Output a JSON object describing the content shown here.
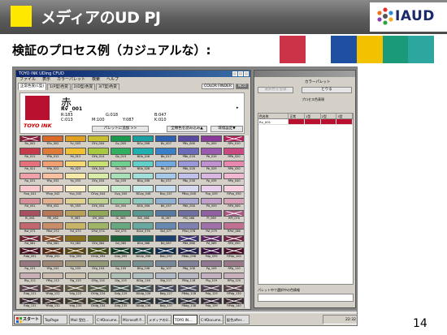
{
  "slide": {
    "title": "メディアのUD PJ",
    "subtitle": "検証のプロセス例（カジュアルな）:",
    "page_number": "14",
    "logo_text": "IAUD",
    "strip_colors": [
      "#cc3348",
      "#ffffff",
      "#1e4fa0",
      "#f2c200",
      "#1a9a78",
      "#2ea6a0"
    ]
  },
  "app": {
    "window_title": "TOYO INK UDing CFUD",
    "menu": [
      "ファイル",
      "表示",
      "カラーパレット",
      "検索",
      "ヘルプ"
    ],
    "tabs": [
      "正常色覚(C型)",
      "1(P型)色覚",
      "2(D型)色覚",
      "3(T型)色覚"
    ],
    "color_finder_label": "COLOR FINDER",
    "nco_label": "NCO",
    "selected": {
      "name": "赤",
      "code": "Rv _001",
      "r": "R:183",
      "g": "G:018",
      "b": "B:047",
      "c": "C:013",
      "m": "M:100",
      "y": "Y:087",
      "k": "K:010"
    },
    "brand": "TOYO INK",
    "palette_add_button": "パレットに追加 >>",
    "apply_all_button": "全類色を読み込み▲",
    "display_settings_button": "環境設定▼",
    "arrow_glyph": "▸"
  },
  "palette": {
    "title": "カラーパレット",
    "register_button": "選択色を登録",
    "restore_button": "とりる",
    "process_label": "プロセス色表現",
    "columns": [
      "色名称",
      "正常",
      "1型",
      "2型",
      "3型"
    ],
    "rows": [
      [
        "Rv_001",
        "",
        "",
        "",
        ""
      ]
    ],
    "footer_label": "パレット中で選択中の色情報"
  },
  "grid": {
    "rows": [
      {
        "labels": [
          "Rv_001",
          "YRv_002",
          "Yv_003",
          "GYv_004",
          "Gv_005",
          "BGv_006",
          "Bv_007",
          "PBv_008",
          "Pv_009",
          "RPv_010"
        ],
        "colors": [
          "#8c1c3a",
          "#d96a28",
          "#e0a020",
          "#c8c030",
          "#1a9a50",
          "#1aa0a0",
          "#3060b0",
          "#5a4aa0",
          "#8a3a9a",
          "#b0205a"
        ],
        "x": [
          1,
          0,
          0,
          0,
          0,
          0,
          0,
          0,
          0,
          1
        ]
      },
      {
        "labels": [
          "Rb_011",
          "YRb_012",
          "Yb_013",
          "GYb_014",
          "Gb_015",
          "BGb_016",
          "Bb_017",
          "PBb_018",
          "Pb_019",
          "RPb_020"
        ],
        "colors": [
          "#c83a4a",
          "#e07a38",
          "#f0c030",
          "#a8c840",
          "#30b060",
          "#20b0b0",
          "#3a80c8",
          "#6a6ab8",
          "#9a5ab0",
          "#c84a80"
        ],
        "x": [
          0,
          0,
          0,
          0,
          0,
          0,
          0,
          0,
          0,
          0
        ]
      },
      {
        "labels": [
          "Rb_021",
          "YRb_022",
          "Yb_023",
          "GYb_024",
          "Gb_025",
          "BGb_026",
          "Bb_027",
          "PBb_028",
          "Pb_029",
          "RPb_030"
        ],
        "colors": [
          "#e8707a",
          "#f0a070",
          "#f8d870",
          "#c8e070",
          "#70d090",
          "#60d0c8",
          "#70a8e0",
          "#9a98d8",
          "#c090d0",
          "#e888b0"
        ],
        "x": [
          0,
          0,
          0,
          0,
          0,
          0,
          0,
          0,
          0,
          0
        ]
      },
      {
        "labels": [
          "Rp_031",
          "YRp_032",
          "Yp_033",
          "GYp_034",
          "Gp_035",
          "BGp_036",
          "Bp_037",
          "PBp_038",
          "Pp_039",
          "RPp_040"
        ],
        "colors": [
          "#f0a0a8",
          "#f8c0a0",
          "#f8e8a8",
          "#d8eca8",
          "#a8e0b8",
          "#a0e0d8",
          "#a8c8e8",
          "#c0c0e8",
          "#d8b8e0",
          "#f0b8d0"
        ],
        "x": [
          0,
          0,
          0,
          0,
          0,
          0,
          0,
          0,
          0,
          0
        ]
      },
      {
        "labels": [
          "Rvp_041",
          "YRvp_042",
          "Yvp_043",
          "GYvp_044",
          "Gvp_045",
          "BGvp_046",
          "Bvp_047",
          "PBvp_048",
          "Pvp_049",
          "RPvp_050"
        ],
        "colors": [
          "#f8c8cc",
          "#fcd8c8",
          "#fcf0c8",
          "#e8f4c8",
          "#c8ecd0",
          "#c8ece8",
          "#c8dcf0",
          "#d8d8f0",
          "#e8d0ec",
          "#f8d0e0"
        ],
        "x": [
          0,
          0,
          0,
          0,
          0,
          0,
          0,
          0,
          0,
          0
        ]
      },
      {
        "labels": [
          "Rlt_051",
          "YRlt_052",
          "Ylt_053",
          "GYlt_054",
          "Glt_055",
          "BGlt_056",
          "Blt_057",
          "PBlt_058",
          "Plt_059",
          "RPlt_060"
        ],
        "colors": [
          "#d89098",
          "#e0b090",
          "#e0d090",
          "#c0d090",
          "#90c8a0",
          "#90c8c0",
          "#90b0d0",
          "#a8a8d0",
          "#c0a0c8",
          "#d8a0b8"
        ],
        "x": [
          0,
          0,
          0,
          0,
          0,
          0,
          0,
          0,
          0,
          0
        ]
      },
      {
        "labels": [
          "Rl_061",
          "YRl_062",
          "Yl_063",
          "GYl_064",
          "Gl_065",
          "BGl_066",
          "Bl_067",
          "PBl_068",
          "Pl_069",
          "RPl_070"
        ],
        "colors": [
          "#a85060",
          "#b87858",
          "#b8a058",
          "#90a858",
          "#589870",
          "#589890",
          "#587aa0",
          "#7070a0",
          "#9060a0",
          "#a85880"
        ],
        "x": [
          0,
          0,
          0,
          0,
          0,
          0,
          0,
          0,
          0,
          1
        ]
      },
      {
        "labels": [
          "Rsf_071",
          "YRsf_072",
          "Ysf_073",
          "GYsf_074",
          "Gsf_075",
          "BGsf_076",
          "Bsf_077",
          "PBsf_078",
          "Psf_079",
          "RPsf_080"
        ],
        "colors": [
          "#c0686e",
          "#c88c68",
          "#c8b468",
          "#a0b468",
          "#68a880",
          "#68a8a0",
          "#6888b0",
          "#8080b0",
          "#a070a8",
          "#c07090"
        ],
        "x": [
          0,
          0,
          0,
          0,
          0,
          0,
          0,
          0,
          0,
          0
        ]
      },
      {
        "labels": [
          "Rd_081",
          "YRd_082",
          "Yd_083",
          "GYd_084",
          "Gd_085",
          "BGd_086",
          "Bd_087",
          "PBd_088",
          "Pd_089",
          "RPd_090"
        ],
        "colors": [
          "#702030",
          "#8a4820",
          "#8a7018",
          "#607020",
          "#1a6038",
          "#1a6060",
          "#1a4070",
          "#3a3070",
          "#5a2060",
          "#702040"
        ],
        "x": [
          1,
          1,
          0,
          0,
          0,
          0,
          0,
          1,
          1,
          1
        ]
      },
      {
        "labels": [
          "Rdp_091",
          "YRdp_092",
          "Ydp_093",
          "GYdp_094",
          "Gdp_095",
          "BGdp_096",
          "Bdp_097",
          "PBdp_098",
          "Pdp_099",
          "RPdp_100"
        ],
        "colors": [
          "#4a1020",
          "#5a2a10",
          "#5a4810",
          "#404a10",
          "#103a20",
          "#103a3a",
          "#102a4a",
          "#20204a",
          "#3a1040",
          "#4a1028"
        ],
        "x": [
          1,
          1,
          1,
          1,
          1,
          1,
          1,
          1,
          1,
          1
        ]
      },
      {
        "labels": [
          "Rg_101",
          "YRg_102",
          "Yg_103",
          "GYg_104",
          "Gg_105",
          "BGg_106",
          "Bg_107",
          "PBg_108",
          "Pg_109",
          "RPg_110"
        ],
        "colors": [
          "#987880",
          "#a08878",
          "#a09878",
          "#909878",
          "#789080",
          "#789090",
          "#788898",
          "#808098",
          "#907890",
          "#987888"
        ],
        "x": [
          0,
          0,
          0,
          0,
          0,
          0,
          0,
          0,
          0,
          0
        ]
      },
      {
        "labels": [
          "Rlg_111",
          "YRlg_112",
          "Ylg_113",
          "GYlg_114",
          "Glg_115",
          "BGlg_116",
          "Blg_117",
          "PBlg_118",
          "Plg_119",
          "RPlg_120"
        ],
        "colors": [
          "#c8b0b4",
          "#ccbcb0",
          "#ccc4b0",
          "#c0c4b0",
          "#b0c0b4",
          "#b0c0c0",
          "#b0b8c4",
          "#b8b8c4",
          "#c0b0c0",
          "#c8b0bc"
        ],
        "x": [
          0,
          0,
          0,
          0,
          0,
          0,
          0,
          0,
          0,
          0
        ]
      },
      {
        "labels": [
          "Rdg_121",
          "YRdg_122",
          "Ydg_123",
          "GYdg_124",
          "Gdg_125",
          "BGdg_126",
          "Bdg_127",
          "PBdg_128",
          "Pdg_129",
          "RPdg_130"
        ],
        "colors": [
          "#5a4048",
          "#604a40",
          "#605840",
          "#505840",
          "#405048",
          "#405050",
          "#404858",
          "#484858",
          "#504050",
          "#584048"
        ],
        "x": [
          1,
          1,
          1,
          1,
          1,
          1,
          1,
          1,
          1,
          1
        ]
      },
      {
        "labels": [
          "Rdg_131",
          "YRdg_132",
          "Ydg_133",
          "GYdg_134",
          "Gdg_135",
          "BGdg_136",
          "Bdg_137",
          "PBdg_138",
          "Pdg_139",
          "RPdg_140"
        ],
        "colors": [
          "#3a2830",
          "#40302a",
          "#403a2a",
          "#343a2a",
          "#2a3430",
          "#2a3434",
          "#2a303a",
          "#30303a",
          "#342834",
          "#3a2830"
        ],
        "x": [
          1,
          1,
          1,
          1,
          1,
          1,
          1,
          1,
          1,
          1
        ]
      }
    ]
  },
  "taskbar": {
    "start": "スタート",
    "items": [
      "TopPage",
      "Mail 受信...",
      "C:¥Docume...",
      "Microsoft P...",
      "メディアのU...",
      "TOYO IN...",
      "C:¥Docume...",
      "配色after..."
    ],
    "active_index": 5,
    "clock": "22:32"
  }
}
